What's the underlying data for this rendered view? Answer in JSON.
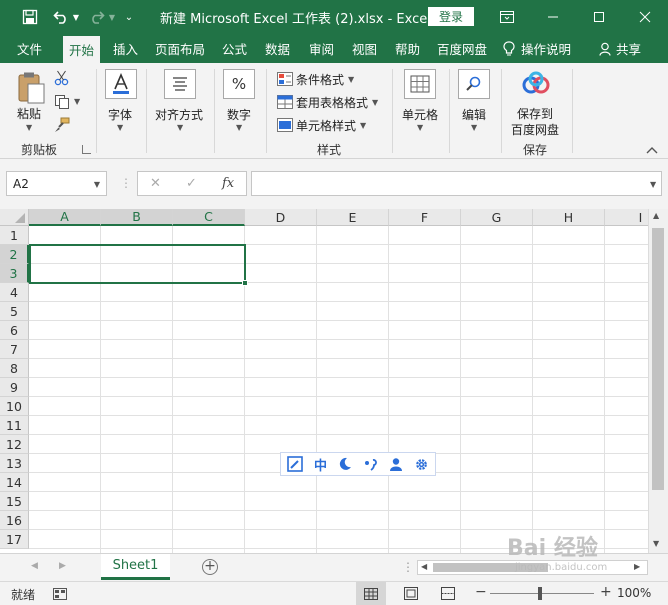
{
  "window": {
    "title": "新建 Microsoft Excel 工作表 (2).xlsx  -  Excel",
    "login_label": "登录",
    "colors": {
      "brand": "#217346",
      "selection": "#217346",
      "ribbon_bg": "#f3f3f3"
    }
  },
  "quick_access": {
    "save_icon": "save-icon",
    "undo_icon": "undo-icon",
    "redo_icon": "redo-icon",
    "customize_icon": "customize-icon"
  },
  "tabs": [
    {
      "label": "文件"
    },
    {
      "label": "开始",
      "active": true
    },
    {
      "label": "插入"
    },
    {
      "label": "页面布局"
    },
    {
      "label": "公式"
    },
    {
      "label": "数据"
    },
    {
      "label": "审阅"
    },
    {
      "label": "视图"
    },
    {
      "label": "帮助"
    },
    {
      "label": "百度网盘"
    }
  ],
  "tell_me": "操作说明",
  "share": "共享",
  "ribbon": {
    "clipboard": {
      "paste": "粘贴",
      "group": "剪贴板"
    },
    "font": {
      "label": "字体"
    },
    "alignment": {
      "label": "对齐方式"
    },
    "number": {
      "label": "数字",
      "icon_glyph": "%"
    },
    "styles": {
      "conditional": "条件格式",
      "table_format": "套用表格格式",
      "cell_styles": "单元格样式",
      "group": "样式"
    },
    "cells": {
      "label": "单元格"
    },
    "editing": {
      "label": "编辑"
    },
    "baidu": {
      "line1": "保存到",
      "line2": "百度网盘",
      "group": "保存"
    }
  },
  "formula_bar": {
    "name_box": "A2",
    "fx": "fx",
    "cancel": "✕",
    "enter": "✓",
    "formula": ""
  },
  "grid": {
    "columns": [
      "A",
      "B",
      "C",
      "D",
      "E",
      "F",
      "G",
      "H",
      "I"
    ],
    "selected_columns": [
      "A",
      "B",
      "C"
    ],
    "rows": [
      "1",
      "2",
      "3",
      "4",
      "5",
      "6",
      "7",
      "8",
      "9",
      "10",
      "11",
      "12",
      "13",
      "14",
      "15",
      "16",
      "17"
    ],
    "selected_rows": [
      "2",
      "3"
    ]
  },
  "ime_toolbar": {
    "mode": "中"
  },
  "sheets": [
    {
      "name": "Sheet1",
      "active": true
    }
  ],
  "status": {
    "ready": "就绪",
    "zoom": "100%"
  },
  "watermark": {
    "text": "Bai 经验",
    "sub": "jingyan.baidu.com"
  }
}
